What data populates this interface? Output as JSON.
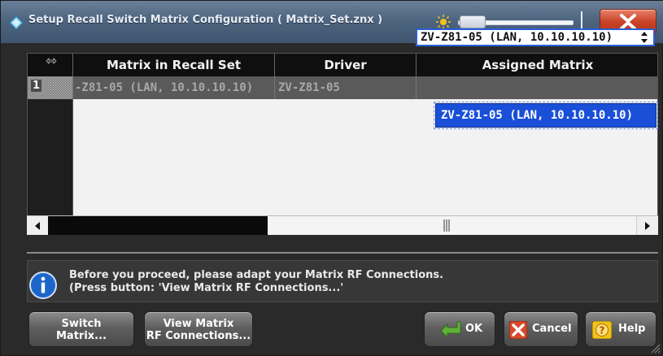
{
  "window": {
    "title": "Setup Recall Switch Matrix Configuration  ( Matrix_Set.znx )"
  },
  "table": {
    "columns": [
      "Matrix in Recall Set",
      "Driver",
      "Assigned Matrix"
    ],
    "rows": [
      {
        "num": "1",
        "matrix": "-Z81-05 (LAN, 10.10.10.10)",
        "driver": "ZV-Z81-05",
        "assigned": "ZV-Z81-05 (LAN, 10.10.10.10)"
      }
    ]
  },
  "dropdown": {
    "options": [
      "ZV-Z81-05 (LAN, 10.10.10.10)"
    ]
  },
  "info": {
    "message": "Before you proceed, please adapt your Matrix RF Connections.\n(Press button: 'View Matrix RF Connections...'"
  },
  "buttons": {
    "switch_matrix": "Switch\nMatrix...",
    "view_rf": "View Matrix\nRF Connections...",
    "ok": "OK",
    "cancel": "Cancel",
    "help": "Help"
  },
  "colors": {
    "title_bar": "#4e6580",
    "close_button": "#c84328",
    "selection_blue": "#1a4fd8",
    "dialog_background": "#262626"
  },
  "icons": {
    "app": "app-logo-icon",
    "brightness": "sun-icon",
    "close": "close-icon",
    "info": "info-icon",
    "ok": "check-arrow-icon",
    "cancel": "x-icon",
    "help": "help-icon"
  }
}
